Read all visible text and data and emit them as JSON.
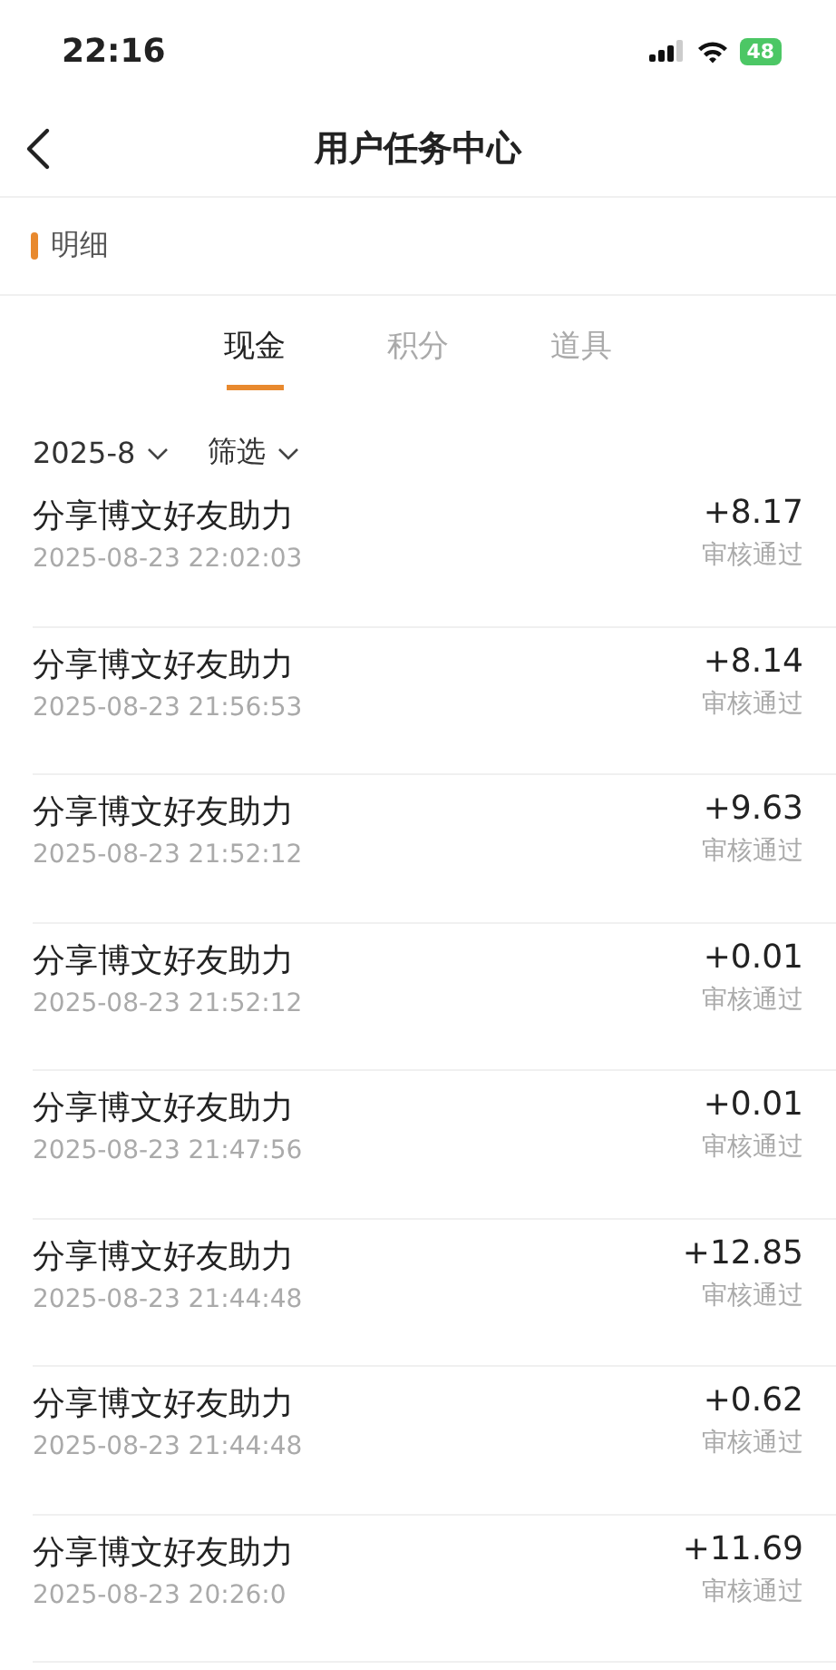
{
  "status_bar": {
    "time": "22:16",
    "battery": "48"
  },
  "nav": {
    "title": "用户任务中心"
  },
  "section": {
    "title": "明细"
  },
  "tabs": [
    {
      "label": "现金",
      "selected": true
    },
    {
      "label": "积分",
      "selected": false
    },
    {
      "label": "道具",
      "selected": false
    }
  ],
  "filters": [
    {
      "label": "2025-8"
    },
    {
      "label": "筛选"
    }
  ],
  "records": [
    {
      "title": "分享博文好友助力",
      "time": "2025-08-23 22:02:03",
      "amount": "+8.17",
      "status": "审核通过"
    },
    {
      "title": "分享博文好友助力",
      "time": "2025-08-23 21:56:53",
      "amount": "+8.14",
      "status": "审核通过"
    },
    {
      "title": "分享博文好友助力",
      "time": "2025-08-23 21:52:12",
      "amount": "+9.63",
      "status": "审核通过"
    },
    {
      "title": "分享博文好友助力",
      "time": "2025-08-23 21:52:12",
      "amount": "+0.01",
      "status": "审核通过"
    },
    {
      "title": "分享博文好友助力",
      "time": "2025-08-23 21:47:56",
      "amount": "+0.01",
      "status": "审核通过"
    },
    {
      "title": "分享博文好友助力",
      "time": "2025-08-23 21:44:48",
      "amount": "+12.85",
      "status": "审核通过"
    },
    {
      "title": "分享博文好友助力",
      "time": "2025-08-23 21:44:48",
      "amount": "+0.62",
      "status": "审核通过"
    },
    {
      "title": "分享博文好友助力",
      "time": "2025-08-23 20:26:0",
      "amount": "+11.69",
      "status": "审核通过"
    }
  ]
}
